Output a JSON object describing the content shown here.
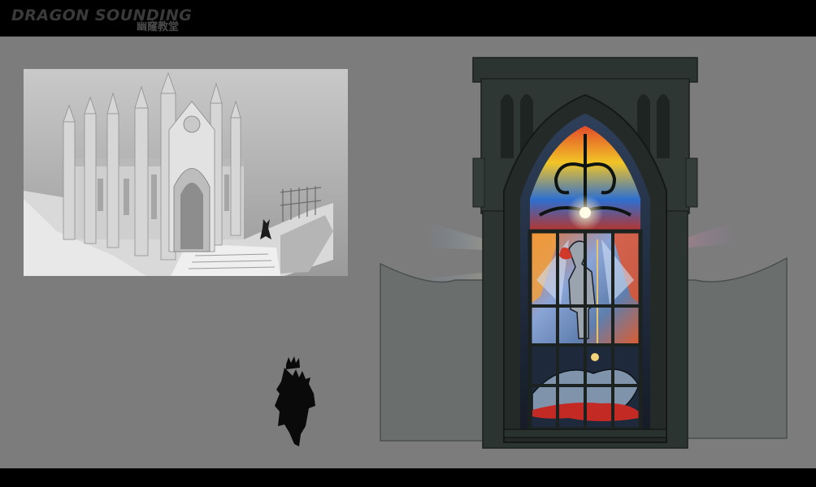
{
  "header": {
    "title": "DRAGON SOUNDING",
    "subtitle": "幽窿教堂"
  },
  "colors": {
    "background": "#7c7c7c",
    "frame_bars": "#000000",
    "window_frame": "#2c3431",
    "wall": "#6a6e6c"
  },
  "artworks": [
    {
      "name": "cathedral-sketch"
    },
    {
      "name": "character-silhouette"
    },
    {
      "name": "stained-glass-window"
    }
  ]
}
